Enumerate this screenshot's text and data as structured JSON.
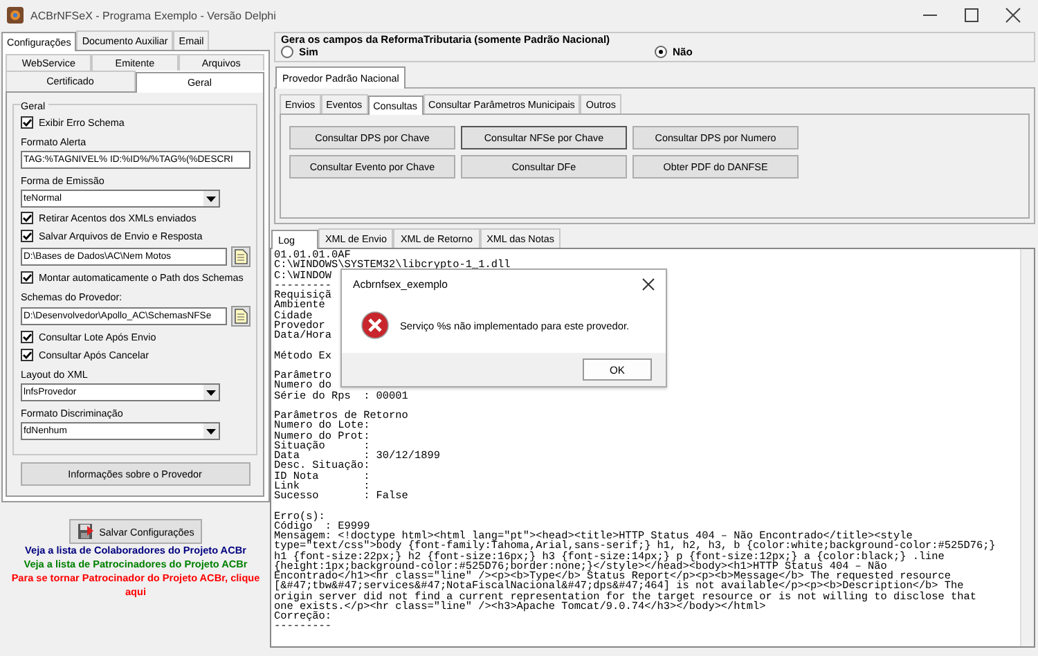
{
  "window": {
    "title": "ACBrNFSeX - Programa Exemplo - Versão Delphi"
  },
  "config_panel": {
    "tabs": [
      {
        "label": "Configurações",
        "selected": true
      },
      {
        "label": "Documento Auxiliar",
        "selected": false
      },
      {
        "label": "Email",
        "selected": false
      }
    ],
    "subtabs_row_1": [
      {
        "label": "WebService",
        "selected": false
      },
      {
        "label": "Emitente",
        "selected": false
      },
      {
        "label": "Arquivos",
        "selected": false
      }
    ],
    "subtabs_row_2": [
      {
        "label": "Certificado",
        "selected": false
      },
      {
        "label": "Geral",
        "selected": true
      }
    ],
    "group": {
      "title": "Geral",
      "fields": [
        {
          "kind": "checkbox",
          "label": "Exibir Erro Schema",
          "checked": true
        },
        {
          "kind": "label",
          "text": "Formato Alerta"
        },
        {
          "kind": "text",
          "value": "TAG:%TAGNIVEL% ID:%ID%/%TAG%(%DESCRI"
        },
        {
          "kind": "label",
          "text": "Forma de Emissão"
        },
        {
          "kind": "select",
          "value": "teNormal"
        },
        {
          "kind": "checkbox",
          "label": "Retirar Acentos dos XMLs enviados",
          "checked": true
        },
        {
          "kind": "checkbox",
          "label": "Salvar Arquivos de Envio e Resposta",
          "checked": true
        },
        {
          "kind": "path",
          "value": "D:\\Bases de Dados\\AC\\Nem Motos"
        },
        {
          "kind": "checkbox",
          "label": "Montar automaticamente o Path dos Schemas",
          "checked": true
        },
        {
          "kind": "label",
          "text": "Schemas do Provedor:"
        },
        {
          "kind": "path",
          "value": "D:\\Desenvolvedor\\Apollo_AC\\SchemasNFSe"
        },
        {
          "kind": "checkbox",
          "label": "Consultar Lote Após Envio",
          "checked": true
        },
        {
          "kind": "checkbox",
          "label": "Consultar Após Cancelar",
          "checked": true
        },
        {
          "kind": "label",
          "text": "Layout do XML"
        },
        {
          "kind": "select",
          "value": "lnfsProvedor"
        },
        {
          "kind": "label",
          "text": "Formato Discriminação"
        },
        {
          "kind": "select",
          "value": "fdNenhum"
        }
      ]
    },
    "info_button": "Informações sobre o Provedor",
    "save_button": "Salvar Configurações",
    "links": [
      {
        "text": "Veja a lista de Colaboradores do Projeto ACBr",
        "color": "#000080"
      },
      {
        "text": "Veja a lista de Patrocinadores do Projeto ACBr",
        "color": "#008000"
      },
      {
        "text": "Para se tornar Patrocinador do Projeto ACBr, clique aqui",
        "color": "#ff0000"
      }
    ]
  },
  "reforma_group": {
    "title": "Gera os campos da ReformaTributaria (somente Padrão Nacional)",
    "options": [
      {
        "label": "Sim",
        "selected": false
      },
      {
        "label": "Não",
        "selected": true
      }
    ]
  },
  "provider_tabs": [
    {
      "label": "Provedor Padrão Nacional",
      "selected": true
    }
  ],
  "operation_tabs": [
    {
      "label": "Envios",
      "selected": false
    },
    {
      "label": "Eventos",
      "selected": false
    },
    {
      "label": "Consultas",
      "selected": true
    },
    {
      "label": "Consultar Parâmetros Municipais",
      "selected": false
    },
    {
      "label": "Outros",
      "selected": false
    }
  ],
  "buttons": [
    {
      "label": "Consultar DPS por Chave",
      "focused": false
    },
    {
      "label": "Consultar NFSe por Chave",
      "focused": true
    },
    {
      "label": "Consultar DPS por Numero",
      "focused": false
    },
    {
      "label": "Consultar Evento por Chave",
      "focused": false
    },
    {
      "label": "Consultar DFe",
      "focused": false
    },
    {
      "label": "Obter PDF do DANFSE",
      "focused": false
    }
  ],
  "output_tabs": [
    {
      "label": "Log",
      "selected": true
    },
    {
      "label": "XML de Envio",
      "selected": false
    },
    {
      "label": "XML de Retorno",
      "selected": false
    },
    {
      "label": "XML das Notas",
      "selected": false
    }
  ],
  "log": {
    "blocks": [
      [
        "01.01.01.0AF",
        "C:\\WINDOWS\\SYSTEM32\\libcrypto-1_1.dll",
        "C:\\WINDOW",
        "---------",
        "Requisiçã",
        "Ambiente",
        "Cidade",
        "Provedor",
        "Data/Hora"
      ],
      [
        "Método Ex"
      ],
      [
        "Parâmetro",
        "Numero do",
        "Série do Rps  : 00001"
      ],
      [
        "Parâmetros de Retorno",
        "Numero do Lote:",
        "Numero do Prot:",
        "Situação      :",
        "Data          : 30/12/1899",
        "Desc. Situação:",
        "ID Nota       :",
        "Link          :",
        "Sucesso       : False"
      ],
      [
        "Erro(s):",
        "Código  : E9999",
        "Mensagem: <!doctype html><html lang=\"pt\"><head><title>HTTP Status 404 – Não Encontrado</title><style",
        "type=\"text/css\">body {font-family:Tahoma,Arial,sans-serif;} h1, h2, h3, b {color:white;background-color:#525D76;}",
        "h1 {font-size:22px;} h2 {font-size:16px;} h3 {font-size:14px;} p {font-size:12px;} a {color:black;} .line",
        "{height:1px;background-color:#525D76;border:none;}</style></head><body><h1>HTTP Status 404 – Não",
        "Encontrado</h1><hr class=\"line\" /><p><b>Type</b> Status Report</p><p><b>Message</b> The requested resource",
        "[&#47;tbw&#47;services&#47;NotaFiscalNacional&#47;dps&#47;464] is not available</p><p><b>Description</b> The",
        "origin server did not find a current representation for the target resource or is not willing to disclose that",
        "one exists.</p><hr class=\"line\" /><h3>Apache Tomcat/9.0.74</h3></body></html>",
        "Correção:",
        "---------"
      ]
    ]
  },
  "dialog": {
    "title": "Acbrnfsex_exemplo",
    "message": "Serviço %s não implementado para este provedor.",
    "button": "OK"
  }
}
